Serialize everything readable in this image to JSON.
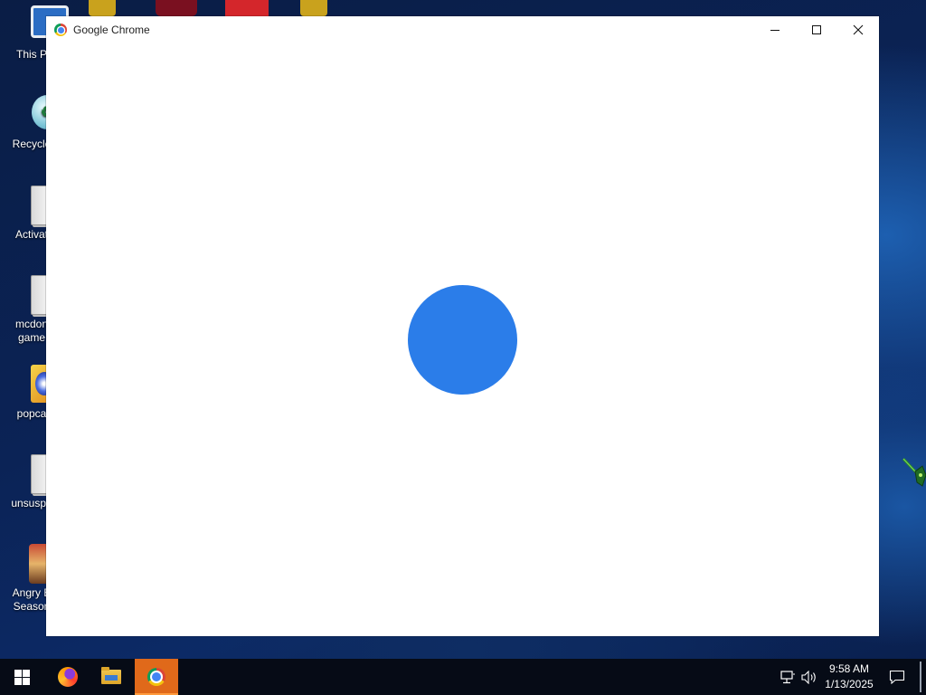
{
  "desktop": {
    "icons": [
      {
        "label": "This P",
        "icon": "this-pc-icon"
      },
      {
        "label": "Recycle",
        "icon": "recycle-bin-icon"
      },
      {
        "label": "Activat",
        "icon": "folder-icon"
      },
      {
        "label": "mcdon game",
        "icon": "folder-icon"
      },
      {
        "label": "popca",
        "icon": "popcap-icon"
      },
      {
        "label": "unsuspe",
        "icon": "folder-icon"
      },
      {
        "label": "Angry B Season",
        "icon": "angry-birds-icon"
      }
    ]
  },
  "window": {
    "title": "Google Chrome",
    "buttons": {
      "minimize": "minimize-icon",
      "maximize": "maximize-icon",
      "close": "close-icon"
    },
    "content": {
      "shape": "circle",
      "color": "#2b7de9"
    }
  },
  "taskbar": {
    "apps": [
      {
        "name": "start",
        "icon": "windows-start-icon"
      },
      {
        "name": "firefox",
        "icon": "firefox-icon"
      },
      {
        "name": "file-explorer",
        "icon": "file-explorer-icon"
      },
      {
        "name": "chrome",
        "icon": "chrome-icon",
        "active": true
      }
    ],
    "clock": {
      "time": "9:58 AM",
      "date": "1/13/2025"
    },
    "accent": "#e0691a"
  }
}
